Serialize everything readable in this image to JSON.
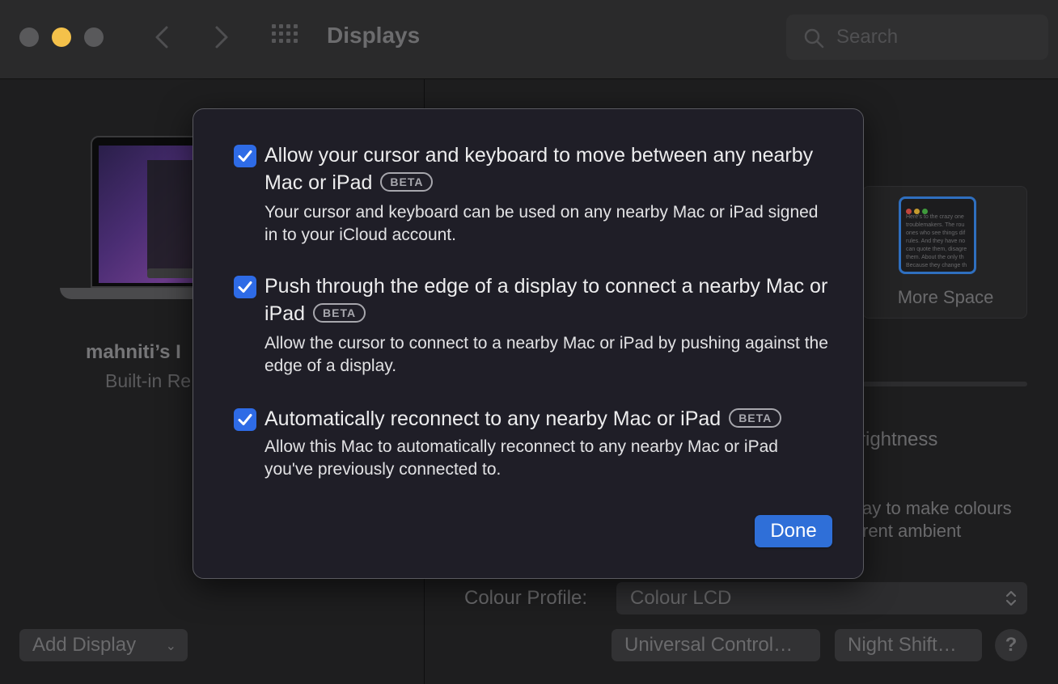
{
  "window": {
    "title": "Displays",
    "search_placeholder": "Search"
  },
  "sidebar": {
    "device_name": "mahniti’s I",
    "device_subtitle": "Built-in Re",
    "add_display_label": "Add Display"
  },
  "main": {
    "more_space_label": "More Space",
    "more_space_thumb_text": "Here's to the crazy one\ntroublemakers. The rou\nones who see things dif\nrules. And they have no\ncan quote them, disagre\nthem. About the only th\nBecause they change th",
    "brightness_partial": "rightness",
    "description_line1": "ay to make colours",
    "description_line2": "rent ambient",
    "colour_profile_label": "Colour Profile:",
    "colour_profile_value": "Colour LCD",
    "universal_control_button": "Universal Control…",
    "night_shift_button": "Night Shift…",
    "help_button": "?"
  },
  "sheet": {
    "options": [
      {
        "checked": true,
        "title": "Allow your cursor and keyboard to move between any nearby Mac or iPad",
        "badge": "BETA",
        "description": "Your cursor and keyboard can be used on any nearby Mac or iPad signed in to your iCloud account."
      },
      {
        "checked": true,
        "title": "Push through the edge of a display to connect a nearby Mac or iPad",
        "badge": "BETA",
        "description": "Allow the cursor to connect to a nearby Mac or iPad by pushing against the edge of a display."
      },
      {
        "checked": true,
        "title": "Automatically reconnect to any nearby Mac or iPad",
        "badge": "BETA",
        "description": "Allow this Mac to automatically reconnect to any nearby Mac or iPad you've previously connected to."
      }
    ],
    "done_label": "Done"
  },
  "colors": {
    "accent": "#2e6be6",
    "sheet_background": "#1f1e27",
    "window_background": "#1e1e1f",
    "minimize_light": "#f4c14a"
  }
}
